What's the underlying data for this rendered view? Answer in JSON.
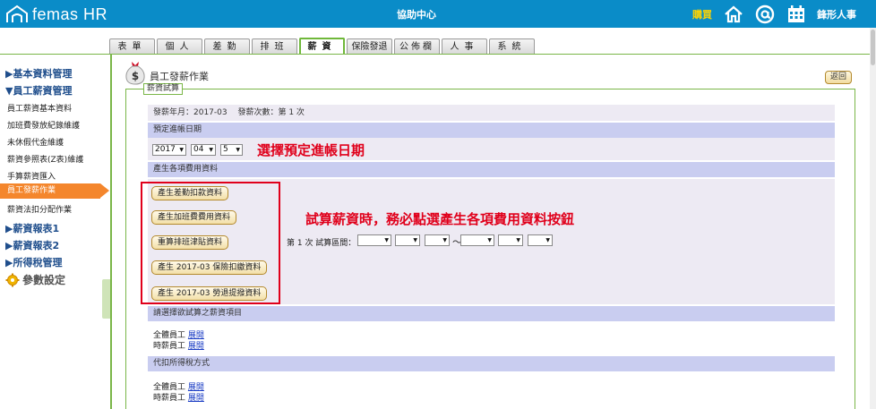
{
  "topbar": {
    "logo_text": "femas HR",
    "help_center": "協助中心",
    "buy": "購買",
    "company": "鋒形人事"
  },
  "tabs": [
    {
      "label": "表單"
    },
    {
      "label": "個人"
    },
    {
      "label": "差勤"
    },
    {
      "label": "排班"
    },
    {
      "label": "薪資",
      "active": true
    },
    {
      "label": "保險發退"
    },
    {
      "label": "公佈欄"
    },
    {
      "label": "人事"
    },
    {
      "label": "系統"
    }
  ],
  "sidebar": {
    "basic": "▶基本資料管理",
    "salary_mgmt": "▼員工薪資管理",
    "items": [
      "員工薪資基本資料",
      "加班費發放紀錄維護",
      "未休假代金維護",
      "薪資參照表(Z表)維護",
      "手算薪資匯入"
    ],
    "active_item": "員工發薪作業",
    "after_item": "薪資法扣分配作業",
    "report1": "▶薪資報表1",
    "report2": "▶薪資報表2",
    "tax": "▶所得稅管理",
    "settings": "參數設定"
  },
  "main": {
    "title": "員工發薪作業",
    "back": "返回",
    "legend": "薪資試算",
    "info": "發薪年月：2017-03　  發薪次數：第 1 次",
    "section_date": "預定進帳日期",
    "date": {
      "year": "2017",
      "month": "04",
      "day": "5"
    },
    "annotation_date": "選擇預定進帳日期",
    "section_costs": "產生各項費用資料",
    "buttons": [
      "產生差勤扣款資料",
      "產生加班費費用資料",
      "重算排班津貼資料",
      "產生 2017-03 保險扣繳資料",
      "產生 2017-03 勞退提撥資料"
    ],
    "annotation_buttons": "試算薪資時，務必點選產生各項費用資料按鈕",
    "range_label": "第 1 次 試算區間：",
    "range_sep": "～",
    "section_items": "請選擇欲試算之薪資項目",
    "all_emp": "全體員工",
    "hourly_emp": "時薪員工",
    "expand": "展開",
    "section_tax": "代扣所得稅方式"
  }
}
